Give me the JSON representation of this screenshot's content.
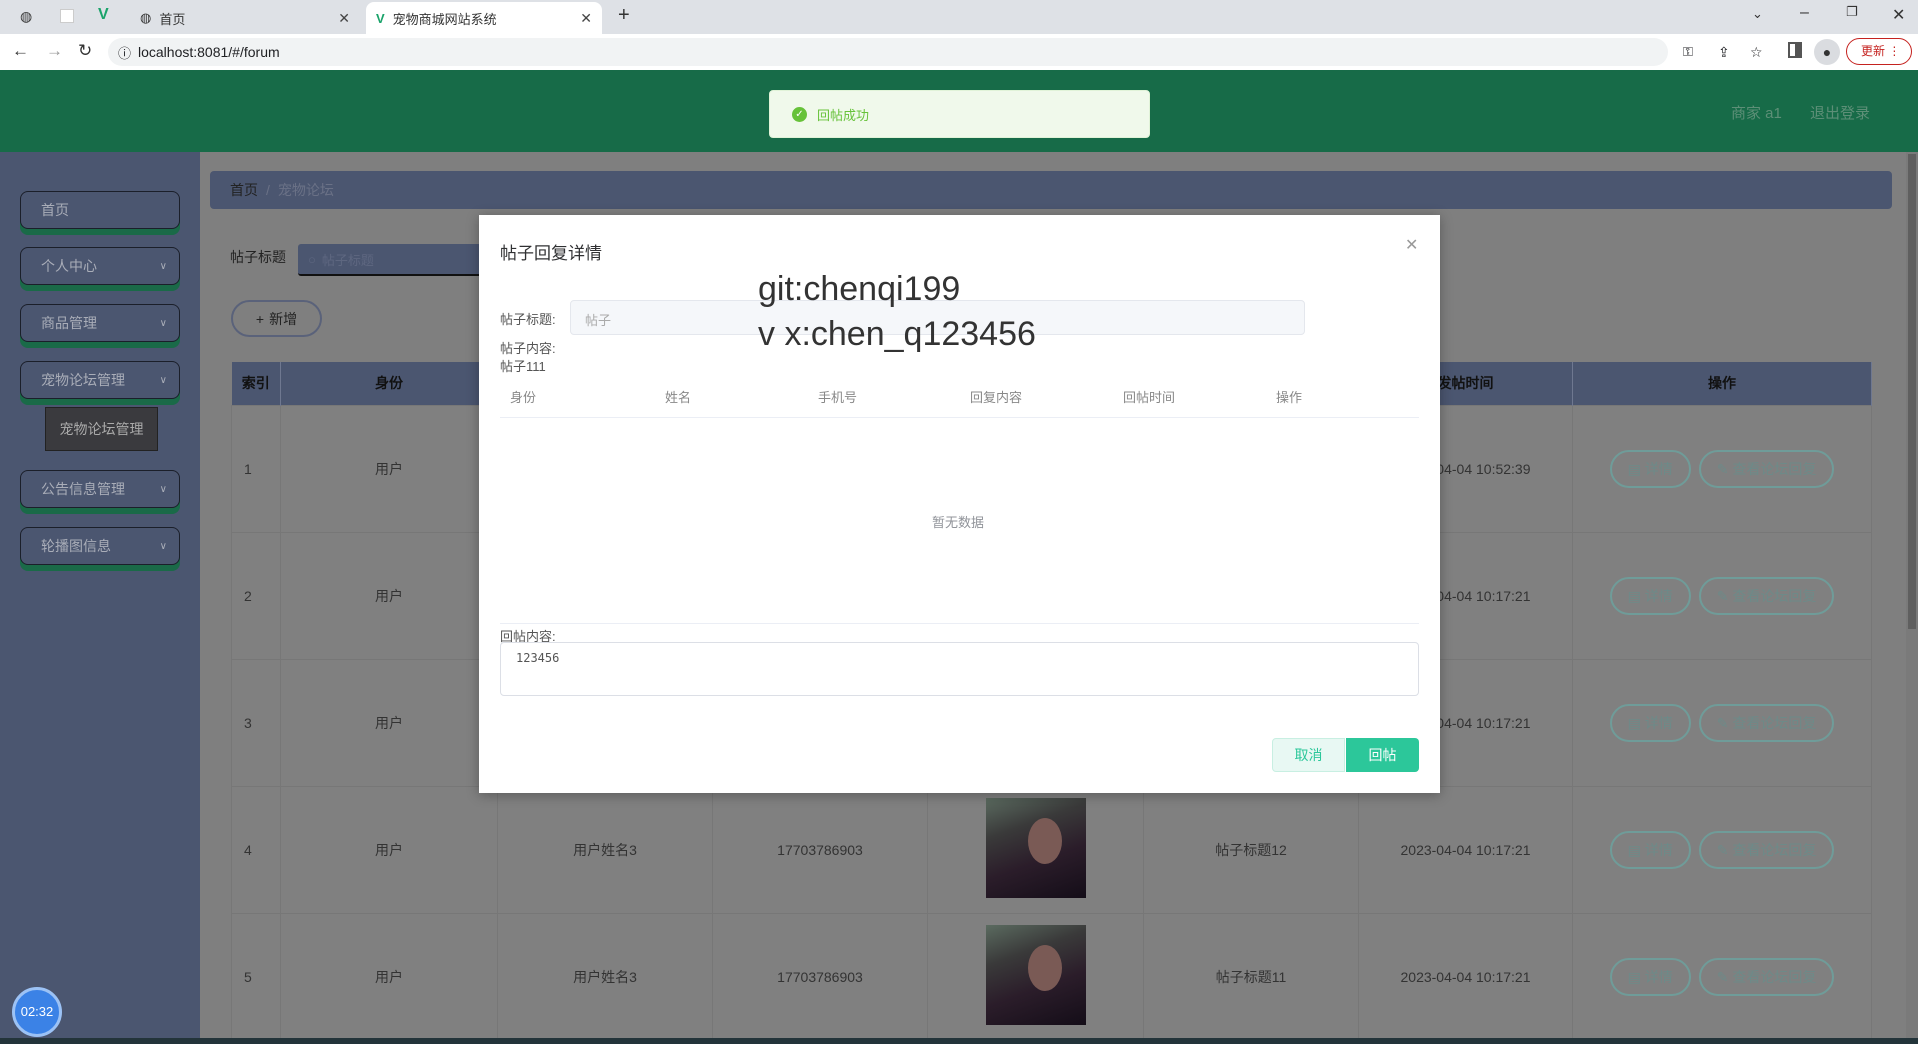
{
  "browser": {
    "tabs": [
      {
        "label": "首页"
      },
      {
        "label": "宠物商城网站系统"
      }
    ],
    "url": "localhost:8081/#/forum",
    "update_label": "更新"
  },
  "header": {
    "user": "商家 a1",
    "logout": "退出登录"
  },
  "toast": {
    "message": "回帖成功"
  },
  "sidebar": {
    "items": [
      {
        "label": "首页"
      },
      {
        "label": "个人中心"
      },
      {
        "label": "商品管理"
      },
      {
        "label": "宠物论坛管理"
      },
      {
        "label": "公告信息管理"
      },
      {
        "label": "轮播图信息"
      }
    ],
    "submenu_popup": "宠物论坛管理"
  },
  "breadcrumb": {
    "home": "首页",
    "current": "宠物论坛"
  },
  "search": {
    "label": "帖子标题",
    "placeholder": "帖子标题"
  },
  "add_button": "新增",
  "table": {
    "headers": {
      "index": "索引",
      "identity": "身份",
      "time": "发帖时间",
      "actions": "操作"
    },
    "detail_label": "详情",
    "reply_label": "查看论坛回复",
    "rows": [
      {
        "index": "1",
        "identity": "用户",
        "name": "",
        "phone": "",
        "title": "",
        "time": "2023-04-04 10:52:39",
        "has_image": false
      },
      {
        "index": "2",
        "identity": "用户",
        "name": "",
        "phone": "",
        "title": "",
        "time": "2023-04-04 10:17:21",
        "has_image": false
      },
      {
        "index": "3",
        "identity": "用户",
        "name": "",
        "phone": "",
        "title": "",
        "time": "2023-04-04 10:17:21",
        "has_image": false
      },
      {
        "index": "4",
        "identity": "用户",
        "name": "用户姓名3",
        "phone": "17703786903",
        "title": "帖子标题12",
        "time": "2023-04-04 10:17:21",
        "has_image": true
      },
      {
        "index": "5",
        "identity": "用户",
        "name": "用户姓名3",
        "phone": "17703786903",
        "title": "帖子标题11",
        "time": "2023-04-04 10:17:21",
        "has_image": true
      }
    ]
  },
  "modal": {
    "title": "帖子回复详情",
    "post_title_label": "帖子标题:",
    "post_title_value": "帖子",
    "post_content_label": "帖子内容:",
    "post_content_value": "帖子111",
    "columns": [
      "身份",
      "姓名",
      "手机号",
      "回复内容",
      "回帖时间",
      "操作"
    ],
    "empty_text": "暂无数据",
    "reply_label": "回帖内容:",
    "reply_value": "123456",
    "cancel_label": "取消",
    "submit_label": "回帖"
  },
  "watermark": {
    "line1": "git:chenqi199",
    "line2": "v x:chen_q123456"
  },
  "timer": "02:32"
}
